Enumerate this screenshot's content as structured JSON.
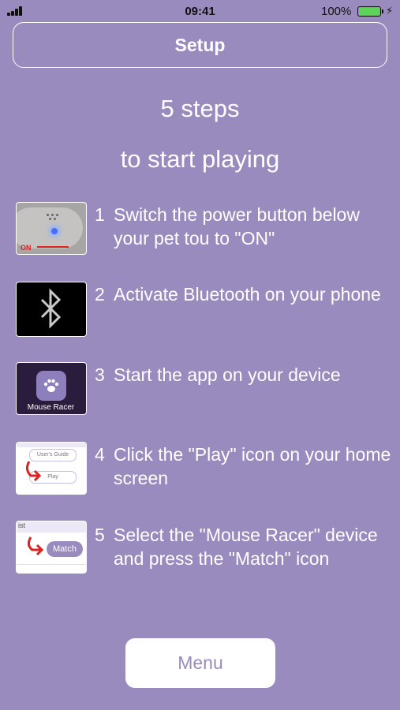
{
  "status_bar": {
    "time": "09:41",
    "battery_percent": "100%",
    "battery_level": 1.0,
    "battery_color": "#5ed35a"
  },
  "header": {
    "title": "Setup"
  },
  "intro": {
    "line1": "5 steps",
    "line2": "to start playing"
  },
  "steps": [
    {
      "number": "1",
      "text": "Switch the power button below your pet tou to \"ON\"",
      "thumb_label": "ON"
    },
    {
      "number": "2",
      "text": "Activate Bluetooth on your phone",
      "thumb_icon": "bluetooth-icon"
    },
    {
      "number": "3",
      "text": "Start the app on your device",
      "thumb_label": "Mouse Racer",
      "thumb_icon": "paw-icon"
    },
    {
      "number": "4",
      "text": "Click the \"Play\" icon on your home screen",
      "thumb_pill1": "User's Guide",
      "thumb_pill2": "Play"
    },
    {
      "number": "5",
      "text": "Select the \"Mouse Racer\" device and press the \"Match\" icon",
      "thumb_list": "ist",
      "thumb_label": "Match"
    }
  ],
  "menu_button": {
    "label": "Menu"
  },
  "colors": {
    "background": "#9a8bbf",
    "text": "#ffffff",
    "accent_red": "#dd2222"
  }
}
